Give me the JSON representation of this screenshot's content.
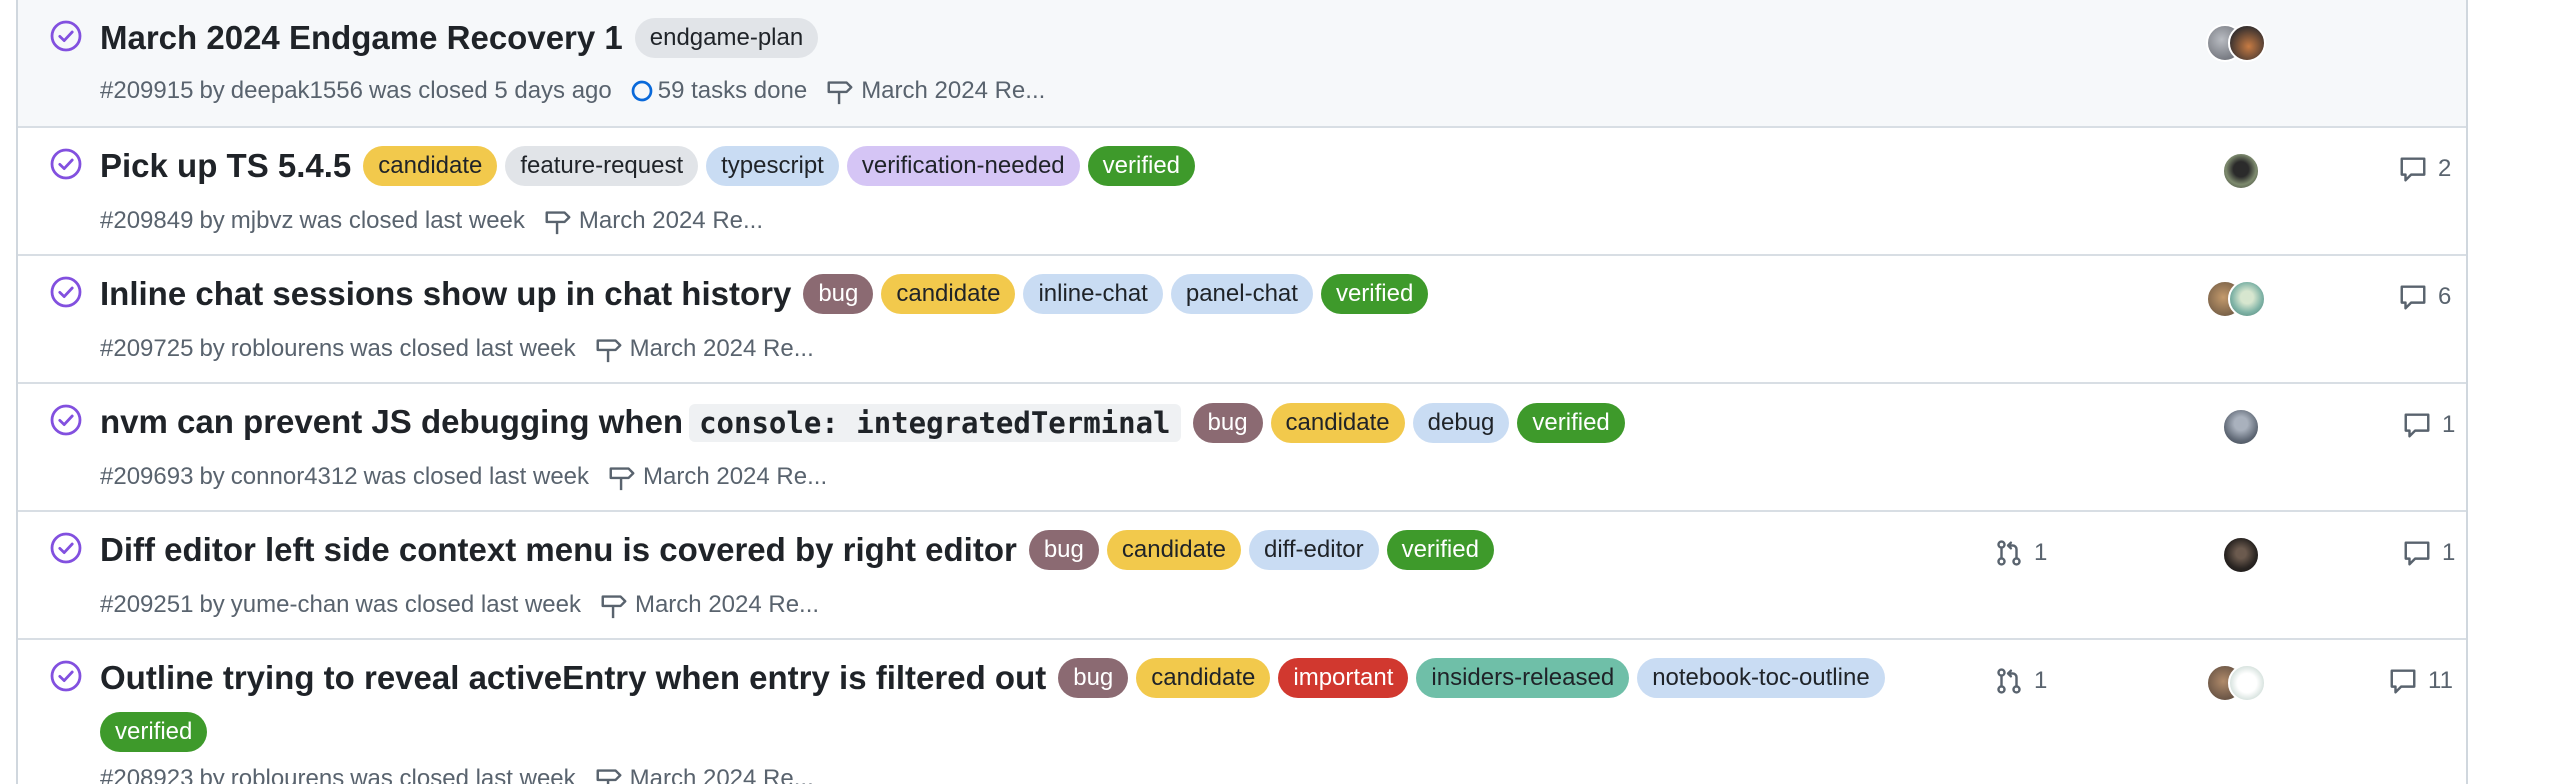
{
  "colors": {
    "bug": "#8b6a72",
    "candidate": "#f2c94c",
    "grey": "#e1e4e8",
    "light_blue": "#c9dcf3",
    "lavender": "#d5c5f5",
    "verified": "#3e9a2b",
    "important": "#d1382f",
    "teal": "#6fbfa8",
    "closed_purple": "#8250df"
  },
  "issues": [
    {
      "title": "March 2024 Endgame Recovery 1",
      "labels": [
        "endgame-plan"
      ],
      "meta": {
        "number": "#209915",
        "by": "by",
        "author": "deepak1556",
        "state": "was closed 5 days ago",
        "tasks": "59 tasks done",
        "milestone": "March 2024 Re..."
      }
    },
    {
      "title": "Pick up TS 5.4.5",
      "labels": [
        "candidate",
        "feature-request",
        "typescript",
        "verification-needed",
        "verified"
      ],
      "meta": {
        "number": "#209849",
        "by": "by",
        "author": "mjbvz",
        "state": "was closed last week",
        "milestone": "March 2024 Re..."
      },
      "comments": "2"
    },
    {
      "title": "Inline chat sessions show up in chat history",
      "labels": [
        "bug",
        "candidate",
        "inline-chat",
        "panel-chat",
        "verified"
      ],
      "meta": {
        "number": "#209725",
        "by": "by",
        "author": "roblourens",
        "state": "was closed last week",
        "milestone": "March 2024 Re..."
      },
      "comments": "6"
    },
    {
      "title": "nvm can prevent JS debugging when",
      "code": "console: integratedTerminal",
      "labels": [
        "bug",
        "candidate",
        "debug",
        "verified"
      ],
      "meta": {
        "number": "#209693",
        "by": "by",
        "author": "connor4312",
        "state": "was closed last week",
        "milestone": "March 2024 Re..."
      },
      "comments": "1"
    },
    {
      "title": "Diff editor left side context menu is covered by right editor",
      "labels": [
        "bug",
        "candidate",
        "diff-editor",
        "verified"
      ],
      "meta": {
        "number": "#209251",
        "by": "by",
        "author": "yume-chan",
        "state": "was closed last week",
        "milestone": "March 2024 Re..."
      },
      "prs": "1",
      "comments": "1"
    },
    {
      "title": "Outline trying to reveal activeEntry when entry is filtered out",
      "labels": [
        "bug",
        "candidate",
        "important",
        "insiders-released",
        "notebook-toc-outline",
        "verified"
      ],
      "meta": {
        "number": "#208923",
        "by": "by",
        "author": "roblourens",
        "state": "was closed last week",
        "milestone": "March 2024 Re..."
      },
      "prs": "1",
      "comments": "11"
    }
  ]
}
